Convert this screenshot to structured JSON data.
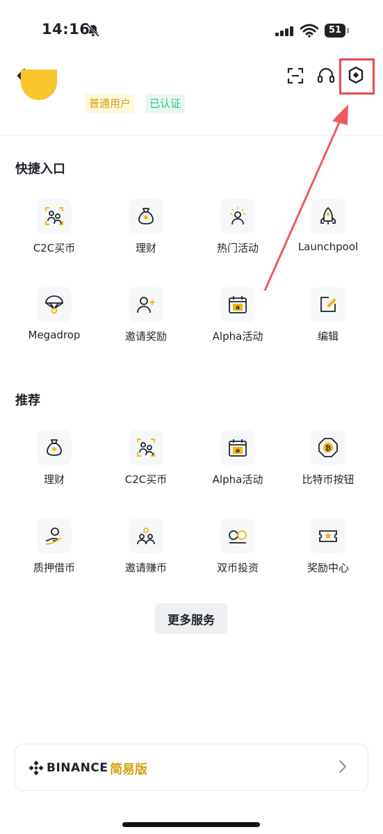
{
  "status_bar": {
    "time": "14:16",
    "battery": "51"
  },
  "header": {
    "back_icon": "arrow-left-icon",
    "scan_icon": "scan-icon",
    "support_icon": "headset-icon",
    "settings_icon": "hexagon-settings-icon"
  },
  "profile": {
    "badges": [
      "普通用户",
      "已认证"
    ]
  },
  "shortcuts": {
    "title": "快捷入口",
    "items": [
      {
        "label": "C2C买币",
        "icon": "c2c-users-icon"
      },
      {
        "label": "理财",
        "icon": "money-bag-icon"
      },
      {
        "label": "热门活动",
        "icon": "person-star-icon"
      },
      {
        "label": "Launchpool",
        "icon": "rocket-icon"
      },
      {
        "label": "Megadrop",
        "icon": "parachute-icon"
      },
      {
        "label": "邀请奖励",
        "icon": "person-add-icon"
      },
      {
        "label": "Alpha活动",
        "icon": "calendar-alpha-icon"
      },
      {
        "label": "编辑",
        "icon": "edit-icon"
      }
    ]
  },
  "recommended": {
    "title": "推荐",
    "items": [
      {
        "label": "理财",
        "icon": "money-bag-icon"
      },
      {
        "label": "C2C买币",
        "icon": "c2c-users-icon"
      },
      {
        "label": "Alpha活动",
        "icon": "calendar-alpha-icon"
      },
      {
        "label": "比特币按钮",
        "icon": "bitcoin-button-icon"
      },
      {
        "label": "质押借币",
        "icon": "hand-coin-icon"
      },
      {
        "label": "邀请赚币",
        "icon": "two-users-icon"
      },
      {
        "label": "双币投资",
        "icon": "dual-coin-icon"
      },
      {
        "label": "奖励中心",
        "icon": "ticket-star-icon"
      }
    ]
  },
  "more_services": "更多服务",
  "lite_card": {
    "brand": "BINANCE",
    "label": "简易版"
  },
  "colors": {
    "accent": "#F0B90B",
    "highlight": "#E8494F",
    "green": "#2EBD85"
  }
}
